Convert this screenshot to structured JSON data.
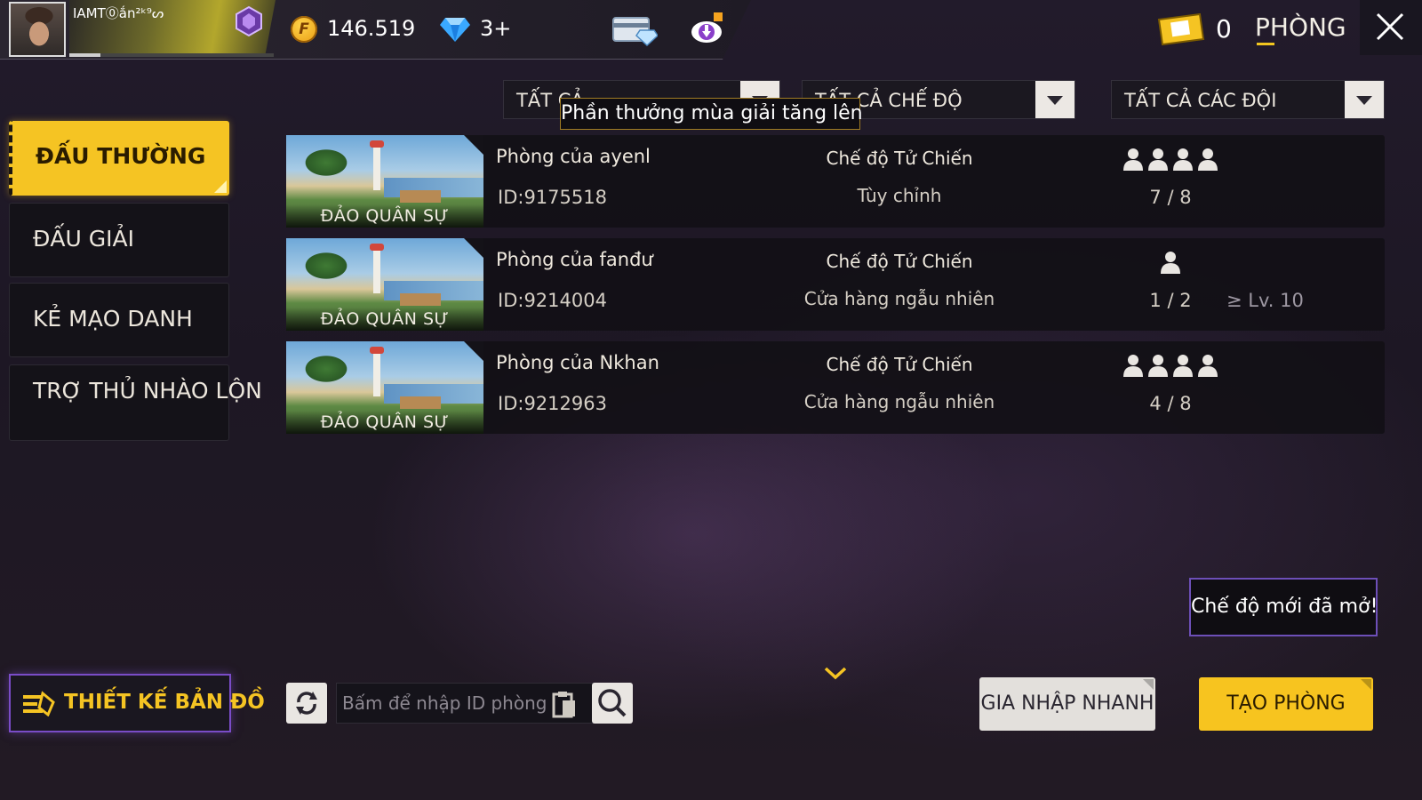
{
  "profile": {
    "player_name": "IAMT⓪ắn²ᵏ⁹ᔕ",
    "xp_fraction": 0.15,
    "rank_icon": "rank-emblem-icon"
  },
  "currency": {
    "coin_symbol": "F",
    "coins": "146.519",
    "diamonds": "3+"
  },
  "header": {
    "tickets": "0",
    "title": "PHÒNG"
  },
  "filters": {
    "type": "TẤT CẢ",
    "mode": "TẤT CẢ CHẾ ĐỘ",
    "team": "TẤT CẢ CÁC ĐỘI",
    "tooltip": "Phần thưởng mùa giải tăng lên"
  },
  "tabs": [
    {
      "label": "ĐẤU THƯỜNG",
      "active": true
    },
    {
      "label": "ĐẤU GIẢI",
      "active": false
    },
    {
      "label": "KẺ MẠO DANH",
      "active": false
    },
    {
      "label": "TRỢ THỦ NHÀO LỘN",
      "active": false
    }
  ],
  "rooms": [
    {
      "map": "ĐẢO QUÂN SỰ",
      "name": "Phòng của ayenl",
      "id": "ID:9175518",
      "mode": "Chế độ Tử Chiến",
      "sub": "Tùy chỉnh",
      "people_icons": 4,
      "count": "7 / 8",
      "level": ""
    },
    {
      "map": "ĐẢO QUÂN SỰ",
      "name": "Phòng của fanđư",
      "id": "ID:9214004",
      "mode": "Chế độ Tử Chiến",
      "sub": "Cửa hàng ngẫu nhiên",
      "people_icons": 1,
      "count": "1 / 2",
      "level": "≥ Lv. 10"
    },
    {
      "map": "ĐẢO QUÂN SỰ",
      "name": "Phòng của Nkhan",
      "id": "ID:9212963",
      "mode": "Chế độ Tử Chiến",
      "sub": "Cửa hàng ngẫu nhiên",
      "people_icons": 4,
      "count": "4 / 8",
      "level": ""
    }
  ],
  "bottom": {
    "map_design": "THIẾT KẾ BẢN ĐỒ",
    "room_id_placeholder": "Bấm để nhập ID phòng",
    "room_id_value": "",
    "new_mode_notice": "Chế độ mới đã mở!",
    "quick_join": "GIA NHẬP NHANH",
    "create_room": "TẠO PHÒNG"
  },
  "colors": {
    "accent": "#f5c423",
    "purple_outline": "#7a4cc7",
    "row_bg": "#121016"
  }
}
